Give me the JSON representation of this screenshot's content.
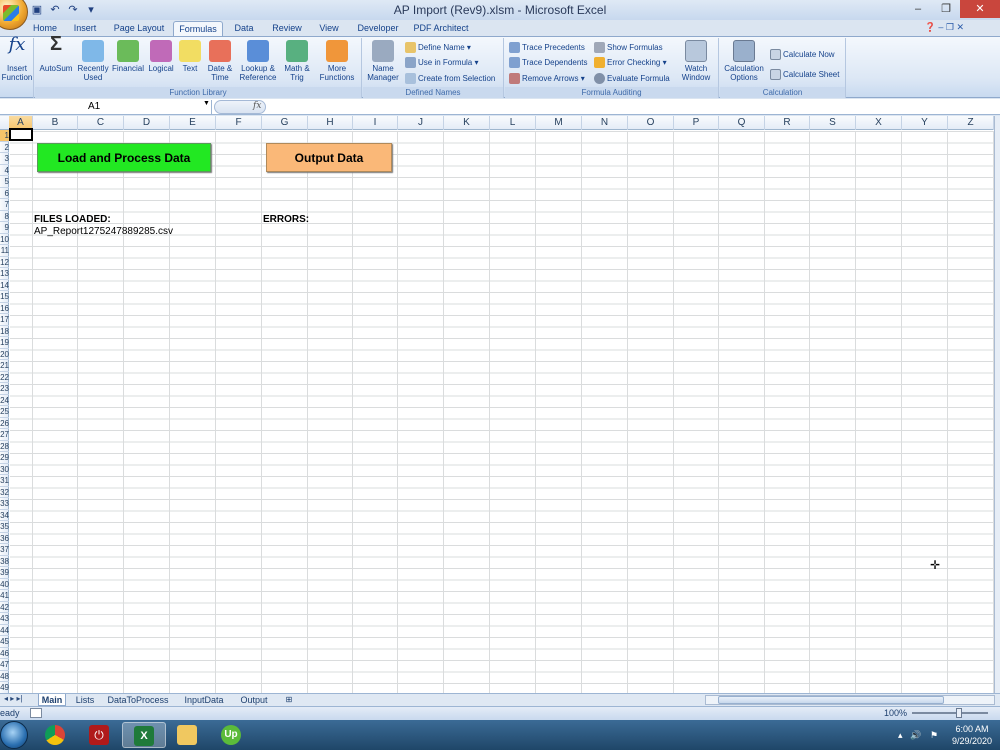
{
  "window": {
    "title": "AP Import (Rev9).xlsm - Microsoft Excel",
    "controls": [
      "–",
      "❐",
      "✕"
    ]
  },
  "quick_access": [
    "save-icon",
    "undo-icon",
    "redo-icon",
    "customize-icon"
  ],
  "ribbon_tabs": [
    {
      "label": "Home"
    },
    {
      "label": "Insert"
    },
    {
      "label": "Page Layout"
    },
    {
      "label": "Formulas",
      "active": true
    },
    {
      "label": "Data"
    },
    {
      "label": "Review"
    },
    {
      "label": "View"
    },
    {
      "label": "Developer"
    },
    {
      "label": "PDF Architect"
    }
  ],
  "ribbon": {
    "insert_function": "Insert Function",
    "function_library": {
      "label": "Function Library",
      "buttons": [
        "AutoSum",
        "Recently Used",
        "Financial",
        "Logical",
        "Text",
        "Date & Time",
        "Lookup & Reference",
        "Math & Trig",
        "More Functions"
      ]
    },
    "defined_names": {
      "label": "Defined Names",
      "name_manager": "Name Manager",
      "define_name": "Define Name",
      "use_in_formula": "Use in Formula",
      "create_from_selection": "Create from Selection"
    },
    "formula_auditing": {
      "label": "Formula Auditing",
      "trace_precedents": "Trace Precedents",
      "trace_dependents": "Trace Dependents",
      "remove_arrows": "Remove Arrows",
      "show_formulas": "Show Formulas",
      "error_checking": "Error Checking",
      "evaluate_formula": "Evaluate Formula",
      "watch_window": "Watch Window"
    },
    "calculation": {
      "label": "Calculation",
      "calculation_options": "Calculation Options",
      "calculate_now": "Calculate Now",
      "calculate_sheet": "Calculate Sheet"
    }
  },
  "formula_bar": {
    "name_box": "A1",
    "fx": "fx",
    "formula": ""
  },
  "columns": [
    "A",
    "B",
    "C",
    "D",
    "E",
    "F",
    "G",
    "H",
    "I",
    "J",
    "K",
    "L",
    "M",
    "N",
    "O",
    "P",
    "Q",
    "R",
    "S",
    "X",
    "Y",
    "Z"
  ],
  "rows": [
    "1",
    "2",
    "3",
    "4",
    "5",
    "6",
    "7",
    "8",
    "9",
    "10",
    "11",
    "12",
    "13",
    "14",
    "15",
    "16",
    "17",
    "18",
    "19",
    "20",
    "21",
    "22",
    "23",
    "24",
    "25",
    "26",
    "27",
    "28",
    "29",
    "30",
    "31",
    "32",
    "33",
    "34",
    "35",
    "36",
    "37",
    "38",
    "39",
    "40",
    "41",
    "42",
    "43",
    "44",
    "45",
    "46",
    "47",
    "48",
    "49"
  ],
  "sheet": {
    "load_button": "Load and Process Data",
    "output_button": "Output Data",
    "files_loaded_label": "FILES LOADED:",
    "file_name": "AP_Report1275247889285.csv",
    "errors_label": "ERRORS:"
  },
  "sheet_tabs": [
    {
      "label": "Main",
      "active": true
    },
    {
      "label": "Lists"
    },
    {
      "label": "DataToProcess"
    },
    {
      "label": "InputData"
    },
    {
      "label": "Output"
    }
  ],
  "status": {
    "ready": "eady",
    "zoom": "100%"
  },
  "taskbar": {
    "apps": [
      "chrome-icon",
      "power-icon",
      "excel-icon",
      "folder-icon",
      "upwork-icon"
    ],
    "time": "6:00 AM",
    "date": "9/29/2020"
  },
  "colors": {
    "load_button": "#22e822",
    "output_button": "#fab878",
    "ribbon_text": "#15428b"
  }
}
